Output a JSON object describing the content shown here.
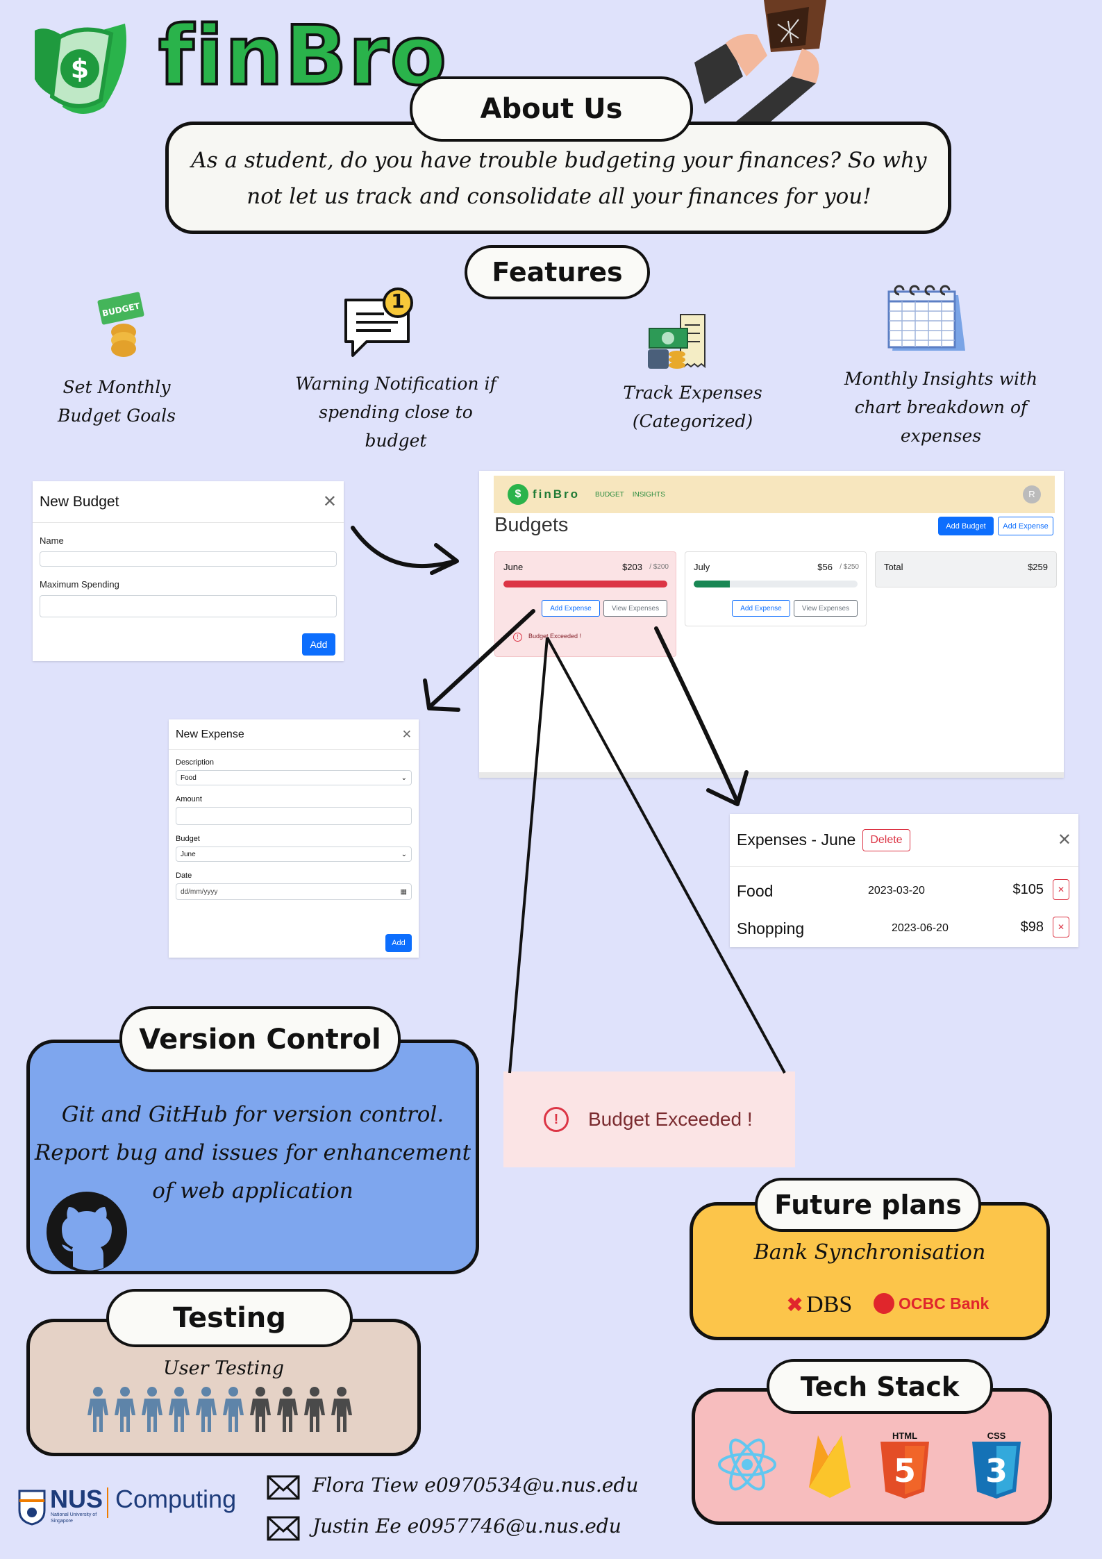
{
  "brand": {
    "name": "finBro"
  },
  "about": {
    "title": "About Us",
    "text": "As a student, do you have trouble budgeting your finances? So why not let us track and consolidate all your finances for you!"
  },
  "features": {
    "title": "Features",
    "items": [
      {
        "label": "Set Monthly Budget Goals",
        "icon": "budget-coins-icon"
      },
      {
        "label": "Warning Notification if spending close to budget",
        "icon": "notification-bubble-icon",
        "badge": "1"
      },
      {
        "label": "Track Expenses (Categorized)",
        "icon": "cash-receipt-icon"
      },
      {
        "label": "Monthly Insights with chart breakdown of expenses",
        "icon": "calendar-icon"
      }
    ]
  },
  "new_budget_modal": {
    "title": "New Budget",
    "name_label": "Name",
    "max_label": "Maximum Spending",
    "add_label": "Add"
  },
  "app_screenshot": {
    "nav_brand": "finBro",
    "nav_links": [
      "BUDGET",
      "INSIGHTS"
    ],
    "avatar": "R",
    "page_title": "Budgets",
    "add_budget_label": "Add Budget",
    "add_expense_label": "Add Expense",
    "cards": [
      {
        "month": "June",
        "spent": "$203",
        "max": "/ $200",
        "progress": 1.0,
        "add_label": "Add Expense",
        "view_label": "View Expenses",
        "warning": "Budget Exceeded !"
      },
      {
        "month": "July",
        "spent": "$56",
        "max": "/ $250",
        "progress": 0.22,
        "add_label": "Add Expense",
        "view_label": "View Expenses"
      }
    ],
    "total_label": "Total",
    "total_value": "$259"
  },
  "new_expense_modal": {
    "title": "New Expense",
    "description_label": "Description",
    "description_value": "Food",
    "amount_label": "Amount",
    "budget_label": "Budget",
    "budget_value": "June",
    "date_label": "Date",
    "date_placeholder": "dd/mm/yyyy",
    "add_label": "Add"
  },
  "expenses_modal": {
    "title": "Expenses - June",
    "delete_label": "Delete",
    "rows": [
      {
        "name": "Food",
        "date": "2023-03-20",
        "amount": "$105"
      },
      {
        "name": "Shopping",
        "date": "2023-06-20",
        "amount": "$98"
      }
    ]
  },
  "budget_exceeded_zoom": {
    "text": "Budget Exceeded !"
  },
  "version_control": {
    "title": "Version Control",
    "text": "Git and GitHub for version control. Report bug and issues for enhancement of web application"
  },
  "testing": {
    "title": "Testing",
    "text": "User Testing"
  },
  "future_plans": {
    "title": "Future plans",
    "text": "Bank Synchronisation",
    "banks": [
      "DBS",
      "OCBC Bank"
    ]
  },
  "tech_stack": {
    "title": "Tech Stack",
    "html_label": "HTML",
    "css_label": "CSS"
  },
  "footer": {
    "nus": "NUS",
    "nus_sub": "National University of Singapore",
    "computing": "Computing",
    "contacts": [
      "Flora Tiew e0970534@u.nus.edu",
      "Justin Ee e0957746@u.nus.edu"
    ]
  },
  "colors": {
    "background": "#dfe2fb",
    "brand_green": "#2ab34b",
    "version_control_bg": "#7ea6ee",
    "testing_bg": "#e5d2c6",
    "future_bg": "#fcc54a",
    "tech_bg": "#f7bdbe",
    "danger": "#dc3545",
    "primary": "#0d6efd"
  }
}
